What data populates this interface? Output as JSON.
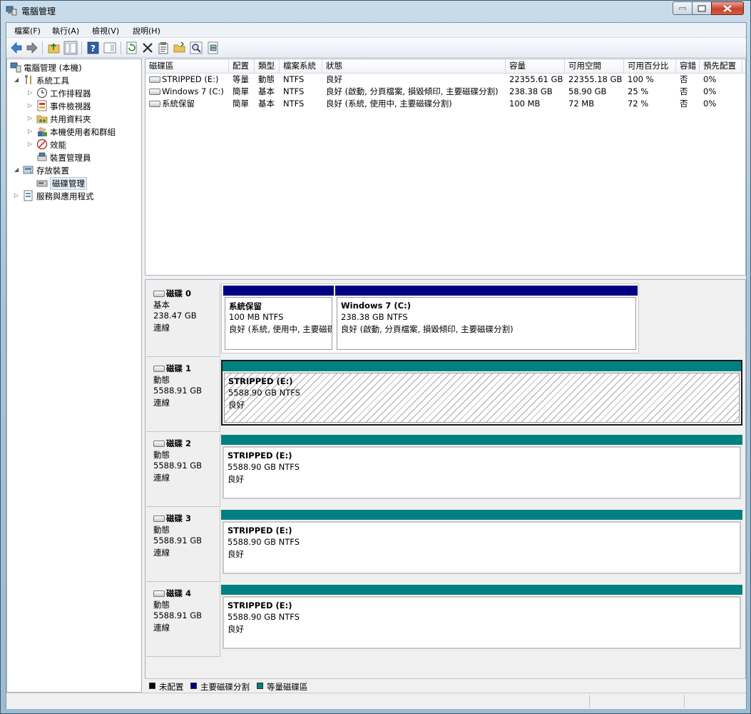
{
  "window": {
    "title": "電腦管理"
  },
  "menu": [
    {
      "label": "檔案(F)"
    },
    {
      "label": "執行(A)"
    },
    {
      "label": "檢視(V)"
    },
    {
      "label": "說明(H)"
    }
  ],
  "toolbar": {
    "buttons": [
      "back-icon",
      "forward-icon",
      "up-folder-icon",
      "show-hide-tree-icon",
      "help-icon",
      "action-pane-icon",
      "refresh-icon",
      "delete-icon",
      "properties-icon",
      "open-icon",
      "search-icon",
      "export-icon"
    ]
  },
  "tree": {
    "root": "電腦管理 (本機)",
    "system_tools": "系統工具",
    "task_scheduler": "工作排程器",
    "event_viewer": "事件檢視器",
    "shared_folders": "共用資料夾",
    "local_users": "本機使用者和群組",
    "performance": "效能",
    "device_manager": "裝置管理員",
    "storage": "存放裝置",
    "disk_management": "磁碟管理",
    "services": "服務與應用程式"
  },
  "volume_table": {
    "headers": [
      "磁碟區",
      "配置",
      "類型",
      "檔案系統",
      "狀態",
      "容量",
      "可用空間",
      "可用百分比",
      "容錯",
      "預先配置"
    ],
    "rows": [
      [
        "STRIPPED (E:)",
        "等量",
        "動態",
        "NTFS",
        "良好",
        "22355.61 GB",
        "22355.18 GB",
        "100 %",
        "否",
        "0%"
      ],
      [
        "Windows 7 (C:)",
        "簡單",
        "基本",
        "NTFS",
        "良好 (啟動, 分頁檔案, 損毀傾印, 主要磁碟分割)",
        "238.38 GB",
        "58.90 GB",
        "25 %",
        "否",
        "0%"
      ],
      [
        "系統保留",
        "簡單",
        "基本",
        "NTFS",
        "良好 (系統, 使用中, 主要磁碟分割)",
        "100 MB",
        "72 MB",
        "72 %",
        "否",
        "0%"
      ]
    ]
  },
  "disks": [
    {
      "name": "磁碟 0",
      "type": "基本",
      "size": "238.47 GB",
      "status": "連線",
      "partitions": [
        {
          "name": "系統保留",
          "size_fs": "100 MB NTFS",
          "status": "良好 (系統, 使用中, 主要磁碟分割)",
          "color": "#000080"
        },
        {
          "name": "Windows 7  (C:)",
          "size_fs": "238.38 GB NTFS",
          "status": "良好 (啟動, 分頁檔案, 損毀傾印, 主要磁碟分割)",
          "color": "#000080"
        }
      ]
    },
    {
      "name": "磁碟 1",
      "type": "動態",
      "size": "5588.91 GB",
      "status": "連線",
      "partitions": [
        {
          "name": "STRIPPED  (E:)",
          "size_fs": "5588.90 GB NTFS",
          "status": "良好",
          "color": "#008080"
        }
      ]
    },
    {
      "name": "磁碟 2",
      "type": "動態",
      "size": "5588.91 GB",
      "status": "連線",
      "partitions": [
        {
          "name": "STRIPPED  (E:)",
          "size_fs": "5588.90 GB NTFS",
          "status": "良好",
          "color": "#008080"
        }
      ]
    },
    {
      "name": "磁碟 3",
      "type": "動態",
      "size": "5588.91 GB",
      "status": "連線",
      "partitions": [
        {
          "name": "STRIPPED  (E:)",
          "size_fs": "5588.90 GB NTFS",
          "status": "良好",
          "color": "#008080"
        }
      ]
    },
    {
      "name": "磁碟 4",
      "type": "動態",
      "size": "5588.91 GB",
      "status": "連線",
      "partitions": [
        {
          "name": "STRIPPED  (E:)",
          "size_fs": "5588.90 GB NTFS",
          "status": "良好",
          "color": "#008080"
        }
      ]
    }
  ],
  "legend": [
    {
      "label": "未配置",
      "color": "#000000"
    },
    {
      "label": "主要磁碟分割",
      "color": "#000080"
    },
    {
      "label": "等量磁碟區",
      "color": "#008080"
    }
  ]
}
